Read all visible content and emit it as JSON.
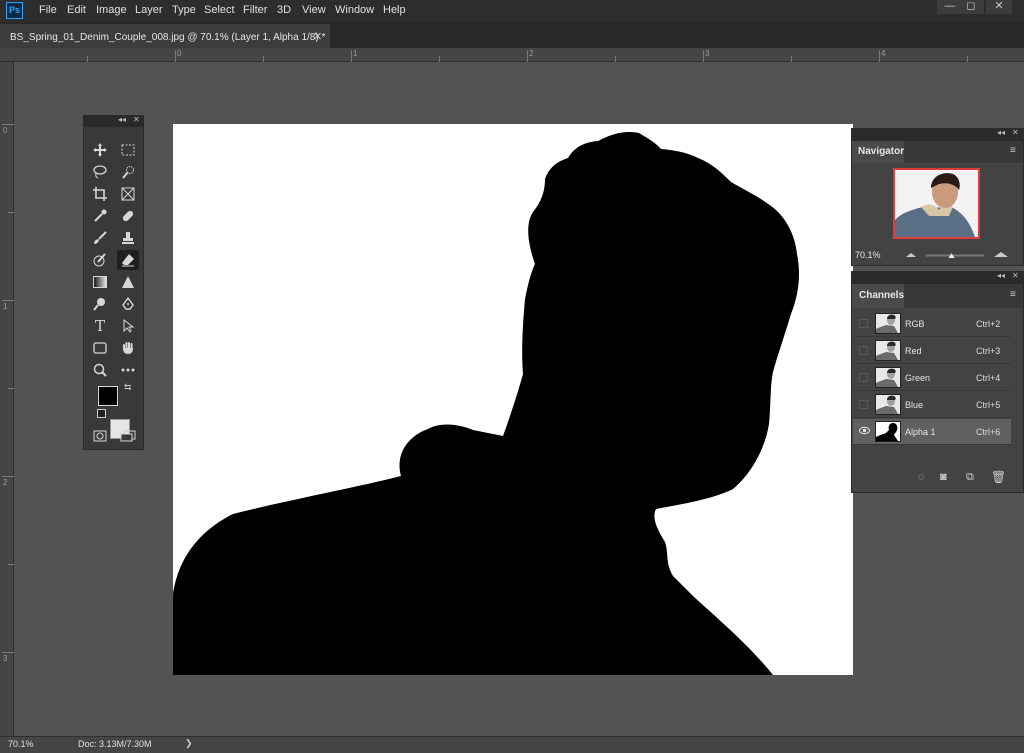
{
  "app": {
    "logo": "Ps"
  },
  "menu": [
    "File",
    "Edit",
    "Image",
    "Layer",
    "Type",
    "Select",
    "Filter",
    "3D",
    "View",
    "Window",
    "Help"
  ],
  "window_controls": {
    "minimize": "—",
    "restore": "◻",
    "close": "✕"
  },
  "document_tab": {
    "title": "BS_Spring_01_Denim_Couple_008.jpg @ 70.1% (Layer 1, Alpha 1/8) *",
    "close": "✕"
  },
  "rulers": {
    "top": [
      "0",
      "1",
      "2",
      "3",
      "4"
    ],
    "left": [
      "0",
      "1",
      "2",
      "3"
    ]
  },
  "toolbox": {
    "collapse": "◂◂",
    "close": "✕",
    "tools": [
      "move-tool",
      "marquee-tool",
      "lasso-tool",
      "quick-selection-tool",
      "crop-tool",
      "frame-tool",
      "eyedropper-tool",
      "healing-brush-tool",
      "brush-tool",
      "clone-stamp-tool",
      "history-brush-tool",
      "eraser-tool",
      "gradient-tool",
      "blur-tool",
      "dodge-tool",
      "pen-tool",
      "type-tool",
      "path-selection-tool",
      "rectangle-tool",
      "hand-tool",
      "zoom-tool",
      "edit-toolbar-tool"
    ],
    "active_tool": "eraser-tool",
    "foreground_color": "#000000",
    "background_color": "#e6e6e6"
  },
  "navigator": {
    "tab_label": "Navigator",
    "zoom": "70.1%",
    "zoom_slider_level": 0.44,
    "frame_color": "#e03c3c"
  },
  "channels": {
    "tab_label": "Channels",
    "rows": [
      {
        "name": "RGB",
        "shortcut": "Ctrl+2",
        "visible": false,
        "selected": false
      },
      {
        "name": "Red",
        "shortcut": "Ctrl+3",
        "visible": false,
        "selected": false
      },
      {
        "name": "Green",
        "shortcut": "Ctrl+4",
        "visible": false,
        "selected": false
      },
      {
        "name": "Blue",
        "shortcut": "Ctrl+5",
        "visible": false,
        "selected": false
      },
      {
        "name": "Alpha 1",
        "shortcut": "Ctrl+6",
        "visible": true,
        "selected": true
      }
    ]
  },
  "status": {
    "zoom": "70.1%",
    "doc_info": "Doc: 3.13M/7.30M",
    "arrow": "❯"
  }
}
